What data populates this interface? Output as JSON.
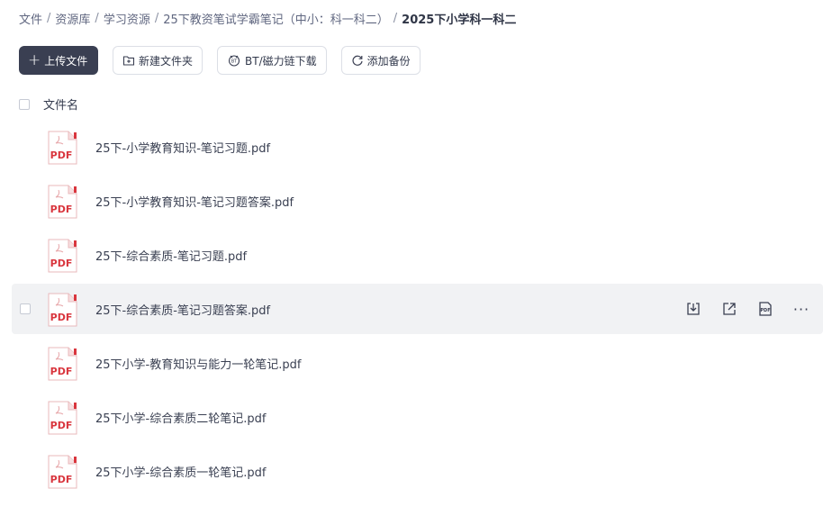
{
  "breadcrumb": {
    "items": [
      "文件",
      "资源库",
      "学习资源",
      "25下教资笔试学霸笔记（中小：科一科二）"
    ],
    "current": "2025下小学科一科二"
  },
  "toolbar": {
    "upload_label": "上传文件",
    "new_folder_label": "新建文件夹",
    "bt_label": "BT/磁力链下载",
    "backup_label": "添加备份"
  },
  "header": {
    "name_label": "文件名"
  },
  "pdf_icon_text": "PDF",
  "files": [
    {
      "name": "25下-小学教育知识-笔记习题.pdf"
    },
    {
      "name": "25下-小学教育知识-笔记习题答案.pdf"
    },
    {
      "name": "25下-综合素质-笔记习题.pdf"
    },
    {
      "name": "25下-综合素质-笔记习题答案.pdf"
    },
    {
      "name": "25下小学-教育知识与能力一轮笔记.pdf"
    },
    {
      "name": "25下小学-综合素质二轮笔记.pdf"
    },
    {
      "name": "25下小学-综合素质一轮笔记.pdf"
    }
  ],
  "row_actions": {
    "more_label": "···"
  },
  "colors": {
    "primary_button": "#3a3f52",
    "pdf_red": "#d9363e",
    "hover_row": "#f1f2f4"
  }
}
